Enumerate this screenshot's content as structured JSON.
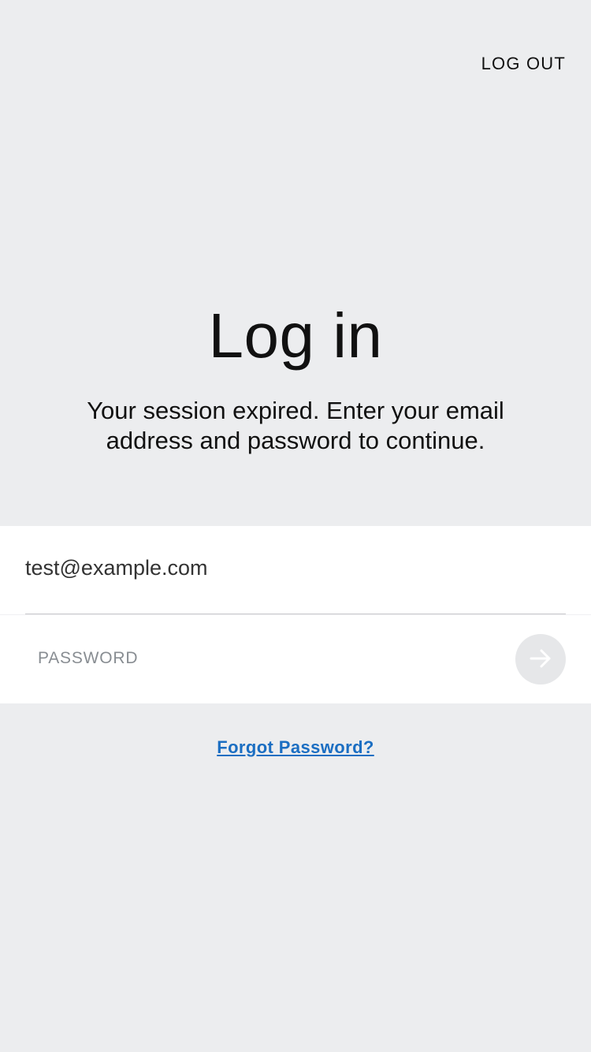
{
  "header": {
    "logout_label": "LOG OUT"
  },
  "main": {
    "title": "Log in",
    "subtitle": "Your session expired. Enter your email address and password to continue."
  },
  "form": {
    "email_value": "test@example.com",
    "password_placeholder": "PASSWORD",
    "submit_icon": "arrow-right-icon"
  },
  "links": {
    "forgot_password": "Forgot Password?"
  },
  "colors": {
    "background": "#ecedef",
    "card": "#ffffff",
    "link": "#1b6ec2",
    "submit_disabled": "#e6e7e9"
  }
}
